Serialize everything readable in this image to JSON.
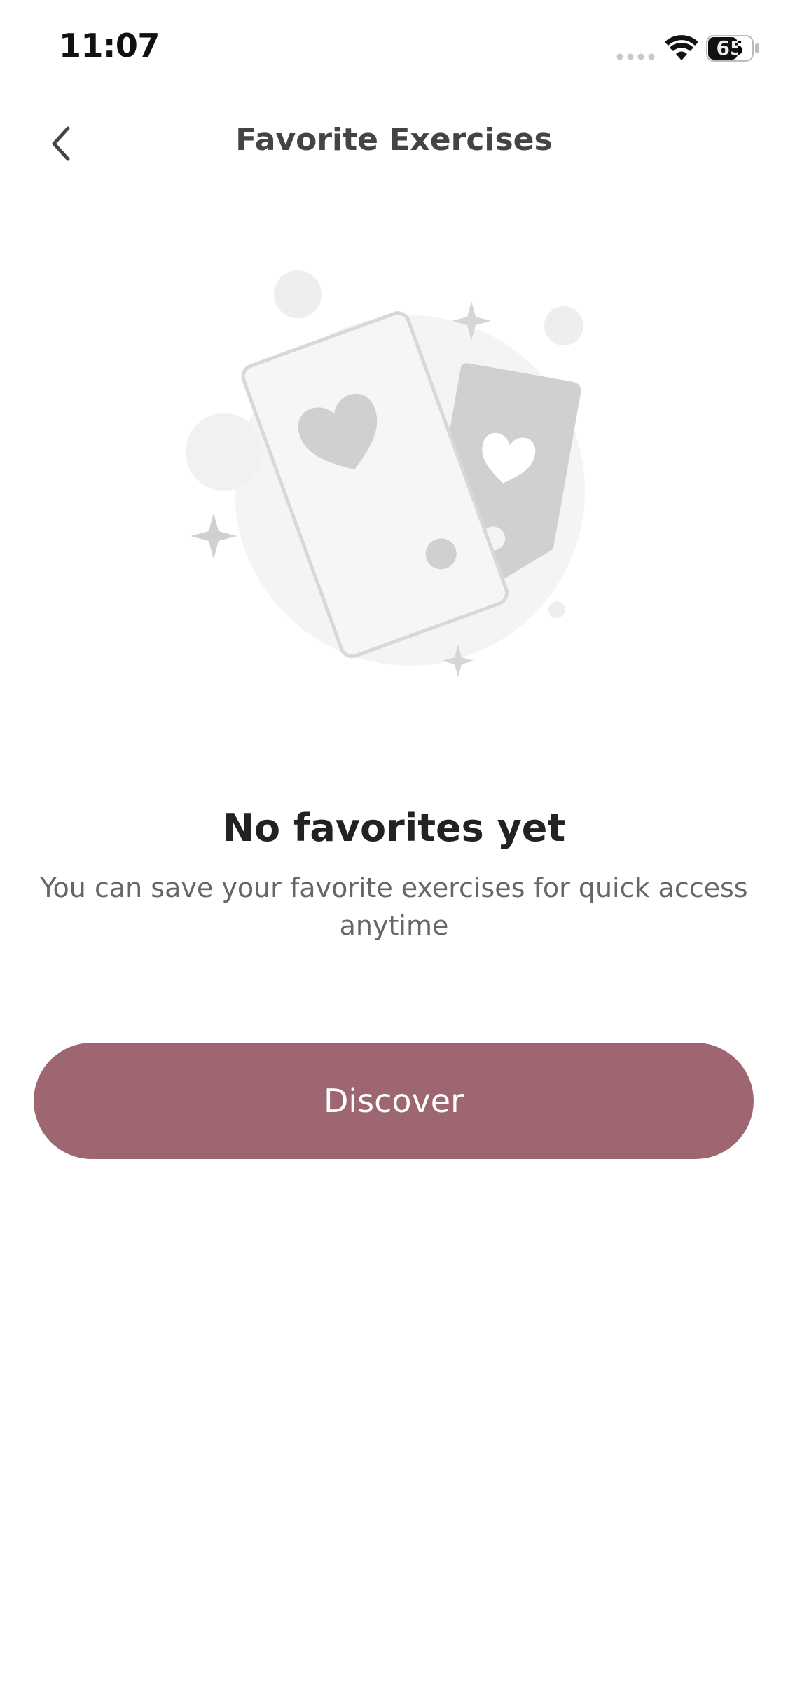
{
  "status_bar": {
    "time": "11:07",
    "battery_level": "65",
    "icons": [
      "signal-icon",
      "wifi-icon",
      "battery-icon"
    ]
  },
  "header": {
    "back_icon": "chevron-left-icon",
    "title": "Favorite Exercises"
  },
  "empty_state": {
    "illustration": "favorite-cards-illustration",
    "title": "No favorites yet",
    "subtitle": "You can save your favorite exercises for quick access anytime"
  },
  "actions": {
    "discover_label": "Discover"
  },
  "colors": {
    "accent": "#9E6670",
    "illustration_gray": "#D0D0D0",
    "illustration_light": "#F4F4F4"
  }
}
